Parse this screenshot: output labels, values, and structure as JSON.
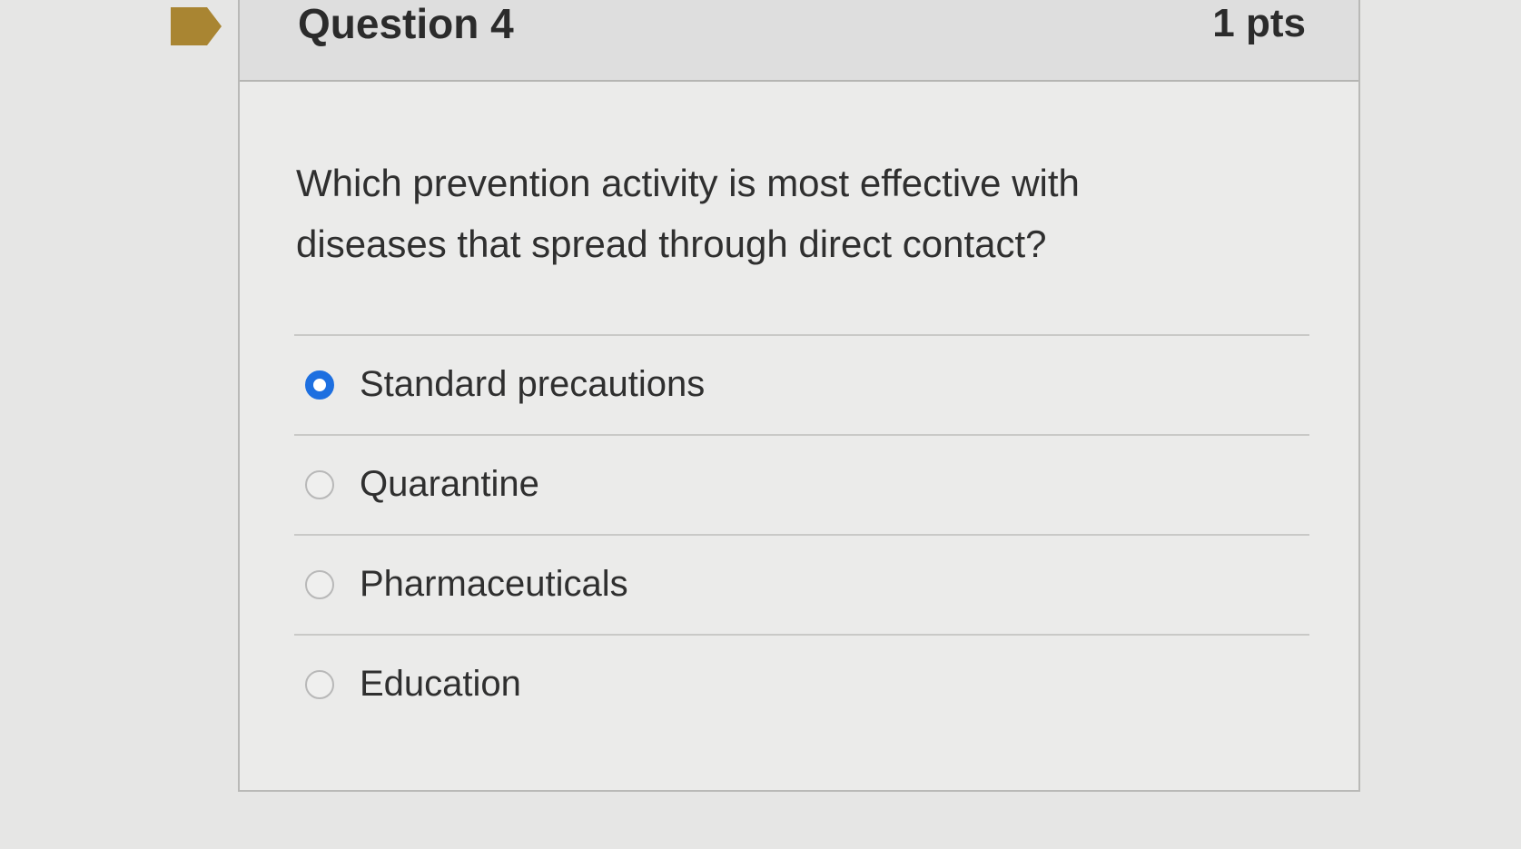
{
  "question": {
    "title": "Question 4",
    "points": "1 pts",
    "text": "Which prevention activity is most effective with diseases that spread through direct contact?"
  },
  "answers": [
    {
      "label": "Standard precautions",
      "selected": true
    },
    {
      "label": "Quarantine",
      "selected": false
    },
    {
      "label": "Pharmaceuticals",
      "selected": false
    },
    {
      "label": "Education",
      "selected": false
    }
  ],
  "icons": {
    "flag": "flag-icon",
    "radio": "radio-button-icon"
  },
  "colors": {
    "flag": "#a98532",
    "radio_selected": "#1d6fe0",
    "background": "#e6e6e5"
  }
}
